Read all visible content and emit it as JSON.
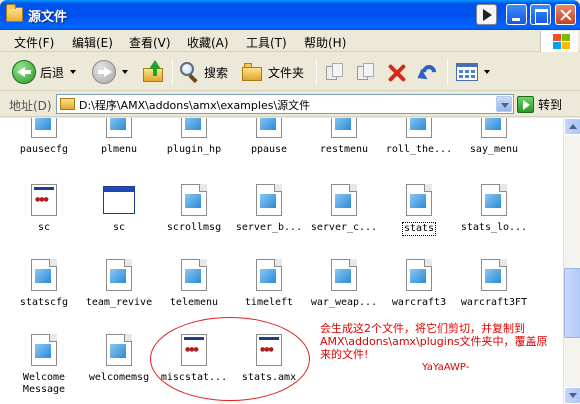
{
  "window": {
    "title": "源文件"
  },
  "menu": [
    "文件(F)",
    "编辑(E)",
    "查看(V)",
    "收藏(A)",
    "工具(T)",
    "帮助(H)"
  ],
  "toolbar": {
    "back": "后退",
    "search": "搜索",
    "folders": "文件夹"
  },
  "address": {
    "label": "地址(D)",
    "path": "D:\\程序\\AMX\\addons\\amx\\examples\\源文件",
    "go": "转到"
  },
  "files": [
    {
      "name": "pausecfg",
      "type": "sma"
    },
    {
      "name": "plmenu",
      "type": "sma"
    },
    {
      "name": "plugin_hp",
      "type": "sma"
    },
    {
      "name": "ppause",
      "type": "sma"
    },
    {
      "name": "restmenu",
      "type": "sma"
    },
    {
      "name": "roll_the...",
      "type": "sma"
    },
    {
      "name": "say_menu",
      "type": "sma"
    },
    {
      "name": "sc",
      "type": "amx"
    },
    {
      "name": "sc",
      "type": "exe"
    },
    {
      "name": "scrollmsg",
      "type": "sma"
    },
    {
      "name": "server_b...",
      "type": "sma"
    },
    {
      "name": "server_c...",
      "type": "sma"
    },
    {
      "name": "stats",
      "type": "sma"
    },
    {
      "name": "stats_lo...",
      "type": "sma"
    },
    {
      "name": "statscfg",
      "type": "sma"
    },
    {
      "name": "team_revive",
      "type": "sma"
    },
    {
      "name": "telemenu",
      "type": "sma"
    },
    {
      "name": "timeleft",
      "type": "sma"
    },
    {
      "name": "war_weap...",
      "type": "sma"
    },
    {
      "name": "warcraft3",
      "type": "sma"
    },
    {
      "name": "warcraft3FT",
      "type": "sma"
    },
    {
      "name": "Welcome Message",
      "type": "sma"
    },
    {
      "name": "welcomemsg",
      "type": "sma"
    },
    {
      "name": "miscstat...",
      "type": "amx"
    },
    {
      "name": "stats.amx",
      "type": "amx"
    }
  ],
  "annotation": {
    "line1": "会生成这2个文件，将它们剪切，并复制到",
    "line2": "AMX\\addons\\amx\\plugins文件夹中，覆盖原",
    "line3": "来的文件!",
    "signature": "YaYaAWP-"
  },
  "colors": {
    "titlebar": "#0053ee",
    "annotation": "#e00000"
  }
}
